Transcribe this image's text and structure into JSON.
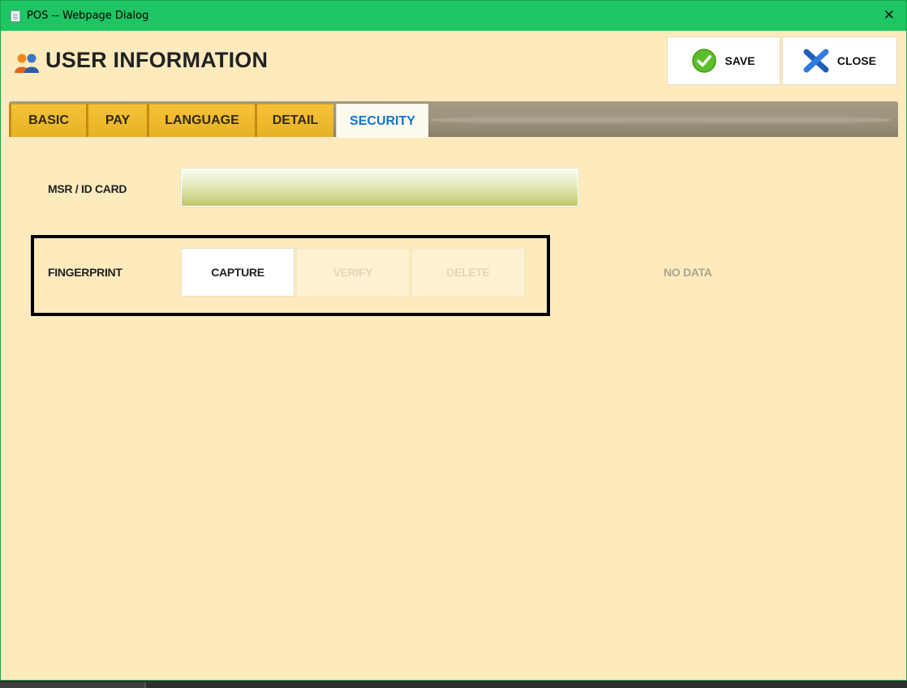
{
  "window": {
    "title": "POS -- Webpage Dialog",
    "close_glyph": "✕"
  },
  "header": {
    "title": "USER INFORMATION",
    "icon": "users-icon",
    "save_label": "SAVE",
    "save_icon": "checkmark-circle-icon",
    "close_label": "CLOSE",
    "close_icon": "x-icon"
  },
  "tabs": [
    {
      "label": "BASIC",
      "active": false
    },
    {
      "label": "PAY",
      "active": false
    },
    {
      "label": "LANGUAGE",
      "active": false
    },
    {
      "label": "DETAIL",
      "active": false
    },
    {
      "label": "SECURITY",
      "active": true
    }
  ],
  "security": {
    "msr_label": "MSR / ID CARD",
    "msr_value": "",
    "fingerprint_label": "FINGERPRINT",
    "capture_label": "CAPTURE",
    "verify_label": "VERIFY",
    "delete_label": "DELETE",
    "status_text": "NO DATA"
  },
  "colors": {
    "titlebar": "#1ec563",
    "background": "#fdebbe",
    "tab_inactive": "#f2bd33",
    "tab_active_text": "#1473c8",
    "tabbar": "#9d927c"
  }
}
